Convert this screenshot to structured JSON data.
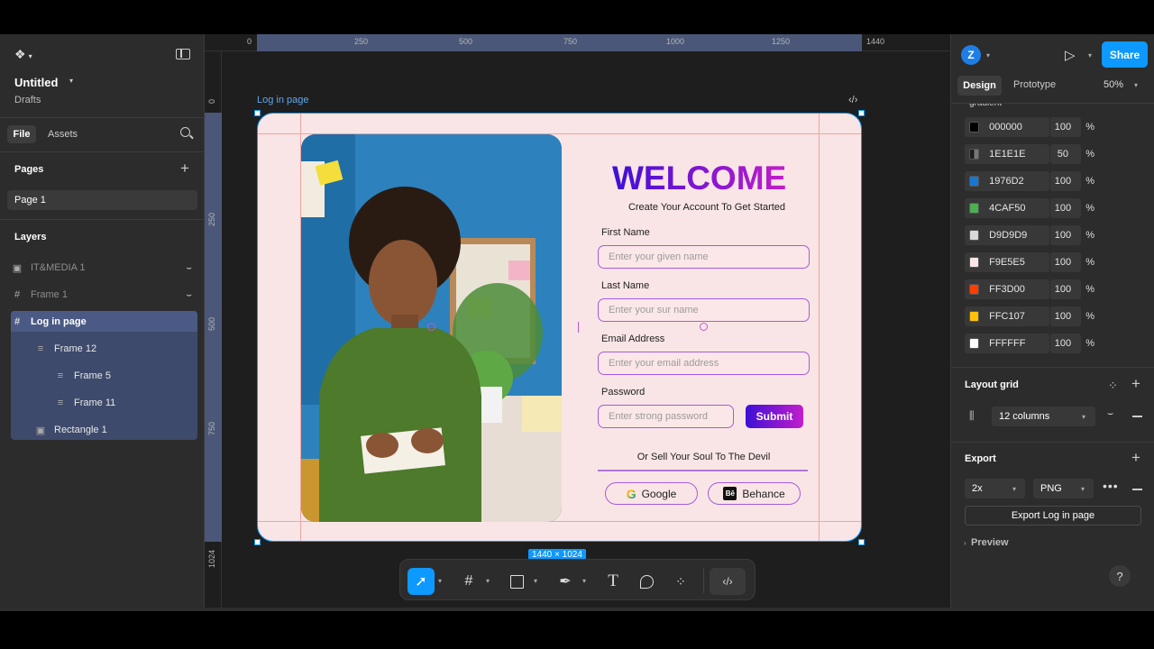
{
  "app": {
    "file_title": "Untitled",
    "location": "Drafts",
    "tabs": {
      "file": "File",
      "assets": "Assets"
    },
    "pages_header": "Pages",
    "page_item": "Page 1",
    "layers_header": "Layers",
    "layers": [
      {
        "label": "IT&MEDIA 1",
        "icon": "image-icon"
      },
      {
        "label": "Frame 1",
        "icon": "frame-icon"
      },
      {
        "label": "Log in page",
        "icon": "frame-icon"
      },
      {
        "label": "Frame 12",
        "icon": "autolayout-icon"
      },
      {
        "label": "Frame 5",
        "icon": "autolayout-icon"
      },
      {
        "label": "Frame 11",
        "icon": "autolayout-icon"
      },
      {
        "label": "Rectangle 1",
        "icon": "image-icon"
      }
    ]
  },
  "ruler": {
    "top": [
      "0",
      "250",
      "500",
      "750",
      "1000",
      "1250",
      "1440"
    ],
    "left": [
      "0",
      "250",
      "500",
      "750",
      "1024"
    ]
  },
  "frame": {
    "name": "Log in page",
    "size_badge": "1440 × 1024"
  },
  "design": {
    "welcome": "WELCOME",
    "subtitle": "Create Your Account To Get Started",
    "fields": [
      {
        "label": "First Name",
        "placeholder": "Enter your given name"
      },
      {
        "label": "Last Name",
        "placeholder": "Enter your sur name"
      },
      {
        "label": "Email Address",
        "placeholder": "Enter your email address"
      },
      {
        "label": "Password",
        "placeholder": "Enter  strong password"
      }
    ],
    "submit": "Submit",
    "divider_text": "Or Sell Your Soul To The Devil",
    "google": "Google",
    "behance": "Behance"
  },
  "right_panel": {
    "avatar_letter": "Z",
    "share": "Share",
    "tab_design": "Design",
    "tab_prototype": "Prototype",
    "zoom": "50%",
    "partial_label": "gradient",
    "swatches": [
      {
        "hex": "000000",
        "opacity": "100",
        "color": "#000000"
      },
      {
        "hex": "1E1E1E",
        "opacity": "50",
        "color": "#1E1E1E"
      },
      {
        "hex": "1976D2",
        "opacity": "100",
        "color": "#1976D2"
      },
      {
        "hex": "4CAF50",
        "opacity": "100",
        "color": "#4CAF50"
      },
      {
        "hex": "D9D9D9",
        "opacity": "100",
        "color": "#D9D9D9"
      },
      {
        "hex": "F9E5E5",
        "opacity": "100",
        "color": "#F9E5E5"
      },
      {
        "hex": "FF3D00",
        "opacity": "100",
        "color": "#FF3D00"
      },
      {
        "hex": "FFC107",
        "opacity": "100",
        "color": "#FFC107"
      },
      {
        "hex": "FFFFFF",
        "opacity": "100",
        "color": "#FFFFFF"
      }
    ],
    "percent": "%",
    "layout_grid_header": "Layout grid",
    "layout_grid_value": "12 columns",
    "export_header": "Export",
    "export_scale": "2x",
    "export_format": "PNG",
    "export_button": "Export Log in page",
    "preview": "Preview",
    "help": "?"
  },
  "colors": {
    "accent": "#0d99ff",
    "welcome_gradient_start": "#3d0fd6",
    "welcome_gradient_end": "#c21ecb",
    "frame_bg": "#f9e5e5"
  }
}
